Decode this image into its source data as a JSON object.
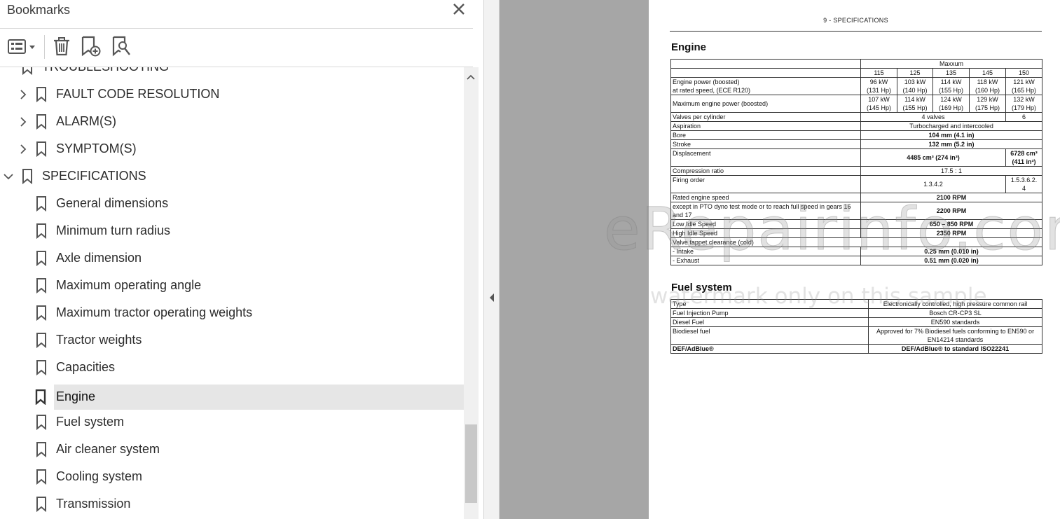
{
  "bookmarks": {
    "title": "Bookmarks",
    "toolbar": {
      "options_icon": "list-options-icon",
      "delete_icon": "trash-icon",
      "add_icon": "add-bookmark-icon",
      "find_icon": "find-bookmark-icon"
    },
    "items": [
      {
        "label": "TROUBLESHOOTING",
        "expandable": false
      },
      {
        "label": "FAULT CODE RESOLUTION",
        "expandable": true
      },
      {
        "label": "ALARM(S)",
        "expandable": true
      },
      {
        "label": "SYMPTOM(S)",
        "expandable": true
      },
      {
        "label": "SPECIFICATIONS",
        "expanded": true
      },
      {
        "label": "General dimensions"
      },
      {
        "label": "Minimum turn radius"
      },
      {
        "label": "Axle dimension"
      },
      {
        "label": "Maximum operating angle"
      },
      {
        "label": "Maximum tractor operating weights"
      },
      {
        "label": "Tractor weights"
      },
      {
        "label": "Capacities"
      },
      {
        "label": "Engine",
        "selected": true
      },
      {
        "label": "Fuel system"
      },
      {
        "label": "Air cleaner system"
      },
      {
        "label": "Cooling system"
      },
      {
        "label": "Transmission"
      }
    ]
  },
  "document": {
    "header": "9 - SPECIFICATIONS",
    "engine": {
      "title": "Engine",
      "model_group": "Maxxum",
      "models": [
        "115",
        "125",
        "135",
        "145",
        "150"
      ],
      "rows": {
        "power_boosted_label_1": "Engine power (boosted)",
        "power_boosted_label_2": "at rated speed, (ECE R120)",
        "power_boosted": [
          [
            "96 kW",
            "(131 Hp)"
          ],
          [
            "103 kW",
            "(140 Hp)"
          ],
          [
            "114 kW",
            "(155 Hp)"
          ],
          [
            "118 kW",
            "(160 Hp)"
          ],
          [
            "121 kW",
            "(165 Hp)"
          ]
        ],
        "max_power_label": "Maximum engine power (boosted)",
        "max_power": [
          [
            "107 kW",
            "(145 Hp)"
          ],
          [
            "114 kW",
            "(155 Hp)"
          ],
          [
            "124 kW",
            "(169 Hp)"
          ],
          [
            "129 kW",
            "(175 Hp)"
          ],
          [
            "132 kW",
            "(179 Hp)"
          ]
        ],
        "valves_label": "Valves per cylinder",
        "valves_main": "4 valves",
        "valves_150": "6",
        "aspiration_label": "Aspiration",
        "aspiration": "Turbocharged and intercooled",
        "bore_label": "Bore",
        "bore": "104 mm (4.1 in)",
        "stroke_label": "Stroke",
        "stroke": "132 mm (5.2 in)",
        "displacement_label": "Displacement",
        "displacement_main": "4485 cm³ (274 in³)",
        "displacement_150_1": "6728 cm³",
        "displacement_150_2": "(411 in³)",
        "compression_label": "Compression ratio",
        "compression": "17.5 : 1",
        "firing_label": "Firing order",
        "firing_main": "1.3.4.2",
        "firing_150_1": "1.5.3.6.2.",
        "firing_150_2": "4",
        "rated_speed_label": "Rated engine speed",
        "rated_speed": "2100 RPM",
        "pto_label": "except in PTO dyno test mode or to reach full speed in gears 16 and 17",
        "pto_speed": "2200 RPM",
        "low_idle_label": "Low Idle Speed",
        "low_idle": "650 – 850 RPM",
        "high_idle_label": "High Idle Speed",
        "high_idle": "2350 RPM",
        "tappet_label": "Valve tappet clearance (cold)",
        "intake_label": "- Intake",
        "intake": "0.25 mm (0.010 in)",
        "exhaust_label": "- Exhaust",
        "exhaust": "0.51 mm (0.020 in)"
      }
    },
    "fuel": {
      "title": "Fuel system",
      "rows": [
        {
          "label": "Type",
          "value": "Electronically controlled, high pressure common rail",
          "bold": false
        },
        {
          "label": "Fuel Injection Pump",
          "value": "Bosch CR-CP3 SL",
          "bold": false
        },
        {
          "label": "Diesel Fuel",
          "value": "EN590 standards",
          "bold": false
        },
        {
          "label": "Biodiesel fuel",
          "value": "Approved for 7% Biodiesel fuels conforming to EN590 or EN14214 standards",
          "bold": false
        },
        {
          "label": "DEF/AdBlue®",
          "value": "DEF/AdBlue® to standard ISO22241",
          "bold": true
        }
      ]
    }
  },
  "watermark": {
    "main": "eRepairinfo.com",
    "sub": "watermark only on this sample"
  }
}
